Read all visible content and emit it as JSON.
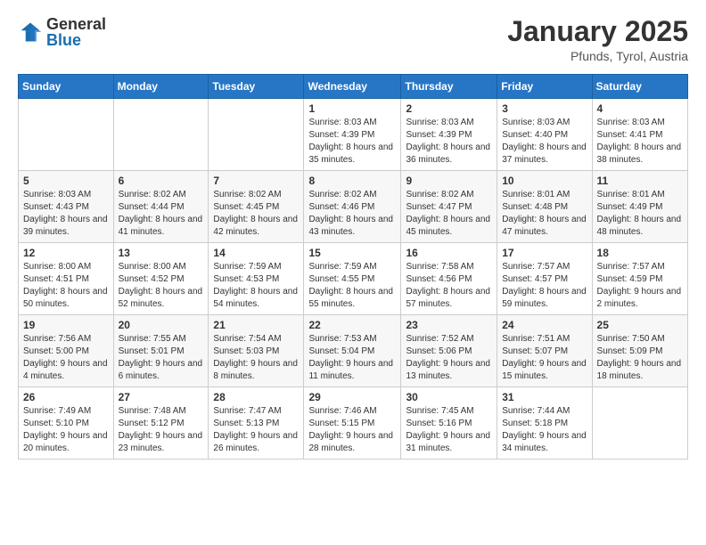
{
  "logo": {
    "general": "General",
    "blue": "Blue"
  },
  "header": {
    "title": "January 2025",
    "subtitle": "Pfunds, Tyrol, Austria"
  },
  "weekdays": [
    "Sunday",
    "Monday",
    "Tuesday",
    "Wednesday",
    "Thursday",
    "Friday",
    "Saturday"
  ],
  "weeks": [
    [
      {
        "day": "",
        "info": ""
      },
      {
        "day": "",
        "info": ""
      },
      {
        "day": "",
        "info": ""
      },
      {
        "day": "1",
        "info": "Sunrise: 8:03 AM\nSunset: 4:39 PM\nDaylight: 8 hours and 35 minutes."
      },
      {
        "day": "2",
        "info": "Sunrise: 8:03 AM\nSunset: 4:39 PM\nDaylight: 8 hours and 36 minutes."
      },
      {
        "day": "3",
        "info": "Sunrise: 8:03 AM\nSunset: 4:40 PM\nDaylight: 8 hours and 37 minutes."
      },
      {
        "day": "4",
        "info": "Sunrise: 8:03 AM\nSunset: 4:41 PM\nDaylight: 8 hours and 38 minutes."
      }
    ],
    [
      {
        "day": "5",
        "info": "Sunrise: 8:03 AM\nSunset: 4:43 PM\nDaylight: 8 hours and 39 minutes."
      },
      {
        "day": "6",
        "info": "Sunrise: 8:02 AM\nSunset: 4:44 PM\nDaylight: 8 hours and 41 minutes."
      },
      {
        "day": "7",
        "info": "Sunrise: 8:02 AM\nSunset: 4:45 PM\nDaylight: 8 hours and 42 minutes."
      },
      {
        "day": "8",
        "info": "Sunrise: 8:02 AM\nSunset: 4:46 PM\nDaylight: 8 hours and 43 minutes."
      },
      {
        "day": "9",
        "info": "Sunrise: 8:02 AM\nSunset: 4:47 PM\nDaylight: 8 hours and 45 minutes."
      },
      {
        "day": "10",
        "info": "Sunrise: 8:01 AM\nSunset: 4:48 PM\nDaylight: 8 hours and 47 minutes."
      },
      {
        "day": "11",
        "info": "Sunrise: 8:01 AM\nSunset: 4:49 PM\nDaylight: 8 hours and 48 minutes."
      }
    ],
    [
      {
        "day": "12",
        "info": "Sunrise: 8:00 AM\nSunset: 4:51 PM\nDaylight: 8 hours and 50 minutes."
      },
      {
        "day": "13",
        "info": "Sunrise: 8:00 AM\nSunset: 4:52 PM\nDaylight: 8 hours and 52 minutes."
      },
      {
        "day": "14",
        "info": "Sunrise: 7:59 AM\nSunset: 4:53 PM\nDaylight: 8 hours and 54 minutes."
      },
      {
        "day": "15",
        "info": "Sunrise: 7:59 AM\nSunset: 4:55 PM\nDaylight: 8 hours and 55 minutes."
      },
      {
        "day": "16",
        "info": "Sunrise: 7:58 AM\nSunset: 4:56 PM\nDaylight: 8 hours and 57 minutes."
      },
      {
        "day": "17",
        "info": "Sunrise: 7:57 AM\nSunset: 4:57 PM\nDaylight: 8 hours and 59 minutes."
      },
      {
        "day": "18",
        "info": "Sunrise: 7:57 AM\nSunset: 4:59 PM\nDaylight: 9 hours and 2 minutes."
      }
    ],
    [
      {
        "day": "19",
        "info": "Sunrise: 7:56 AM\nSunset: 5:00 PM\nDaylight: 9 hours and 4 minutes."
      },
      {
        "day": "20",
        "info": "Sunrise: 7:55 AM\nSunset: 5:01 PM\nDaylight: 9 hours and 6 minutes."
      },
      {
        "day": "21",
        "info": "Sunrise: 7:54 AM\nSunset: 5:03 PM\nDaylight: 9 hours and 8 minutes."
      },
      {
        "day": "22",
        "info": "Sunrise: 7:53 AM\nSunset: 5:04 PM\nDaylight: 9 hours and 11 minutes."
      },
      {
        "day": "23",
        "info": "Sunrise: 7:52 AM\nSunset: 5:06 PM\nDaylight: 9 hours and 13 minutes."
      },
      {
        "day": "24",
        "info": "Sunrise: 7:51 AM\nSunset: 5:07 PM\nDaylight: 9 hours and 15 minutes."
      },
      {
        "day": "25",
        "info": "Sunrise: 7:50 AM\nSunset: 5:09 PM\nDaylight: 9 hours and 18 minutes."
      }
    ],
    [
      {
        "day": "26",
        "info": "Sunrise: 7:49 AM\nSunset: 5:10 PM\nDaylight: 9 hours and 20 minutes."
      },
      {
        "day": "27",
        "info": "Sunrise: 7:48 AM\nSunset: 5:12 PM\nDaylight: 9 hours and 23 minutes."
      },
      {
        "day": "28",
        "info": "Sunrise: 7:47 AM\nSunset: 5:13 PM\nDaylight: 9 hours and 26 minutes."
      },
      {
        "day": "29",
        "info": "Sunrise: 7:46 AM\nSunset: 5:15 PM\nDaylight: 9 hours and 28 minutes."
      },
      {
        "day": "30",
        "info": "Sunrise: 7:45 AM\nSunset: 5:16 PM\nDaylight: 9 hours and 31 minutes."
      },
      {
        "day": "31",
        "info": "Sunrise: 7:44 AM\nSunset: 5:18 PM\nDaylight: 9 hours and 34 minutes."
      },
      {
        "day": "",
        "info": ""
      }
    ]
  ]
}
